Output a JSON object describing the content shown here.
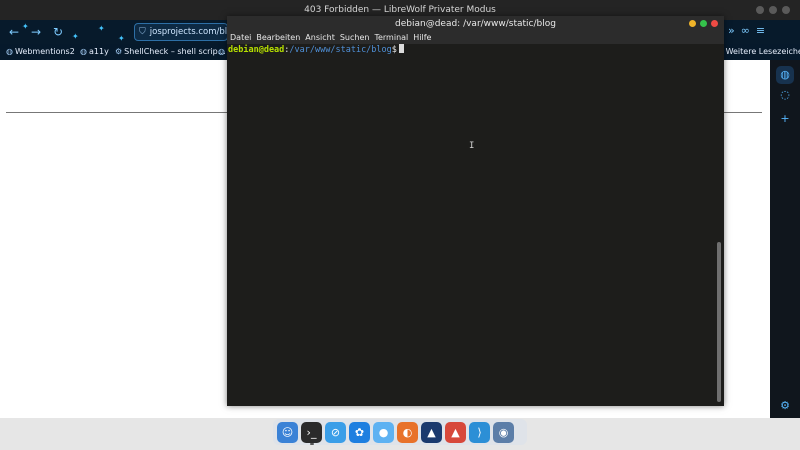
{
  "browser": {
    "window_title": "403 Forbidden — LibreWolf Privater Modus",
    "url": "josprojects.com/blo",
    "nav_icons": {
      "back": "←",
      "forward": "→",
      "reload": "↻"
    },
    "right_icons": [
      "»",
      "∞",
      "≡"
    ],
    "bookmarks": [
      {
        "label": "Webmentions2",
        "icon": "globe"
      },
      {
        "label": "a11y",
        "icon": "globe"
      },
      {
        "label": "ShellCheck – shell scrip…",
        "icon": "shell"
      },
      {
        "label": "",
        "icon": "globe"
      },
      {
        "label": "Weitere Lesezeichen",
        "icon": "folder"
      }
    ]
  },
  "terminal": {
    "title": "debian@dead: /var/www/static/blog",
    "menu": [
      "Datei",
      "Bearbeiten",
      "Ansicht",
      "Suchen",
      "Terminal",
      "Hilfe"
    ],
    "prompt_user": "debian@dead",
    "prompt_sep": ":",
    "prompt_path": "/var/www/static/blog",
    "prompt_sign": "$"
  },
  "dock": {
    "apps": [
      "finder-icon",
      "terminal-icon",
      "safari-icon",
      "puzzle-icon",
      "chat-icon",
      "firefox-icon",
      "affinity-icon",
      "affinity-publisher-icon",
      "vscode-icon",
      "screenshot-icon"
    ]
  },
  "colors": {
    "terminal_bg": "#1d1d1b",
    "prompt_user": "#b7e000",
    "prompt_path": "#4f8fd6",
    "browser_chrome": "#071a2b"
  }
}
